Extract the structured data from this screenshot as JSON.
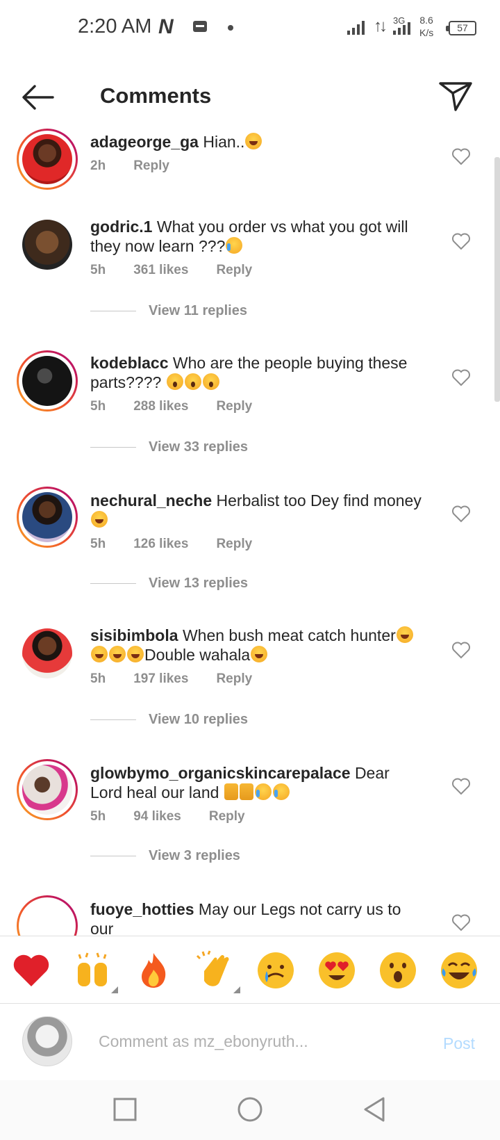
{
  "status_bar": {
    "time": "2:20 AM",
    "net_icon": "N",
    "network": "3G",
    "speed_value": "8.6",
    "speed_unit": "K/s",
    "battery": "57"
  },
  "header": {
    "title": "Comments",
    "back_icon": "arrow-left-icon",
    "send_icon": "paper-plane-icon"
  },
  "comments": [
    {
      "username": "adageorge_ga",
      "text": "Hian..",
      "emoji_after": [
        "laugh"
      ],
      "time": "2h",
      "likes": "",
      "reply_label": "Reply",
      "view_replies": ""
    },
    {
      "username": "godric.1",
      "text": "What you order vs what you got will they now learn ???",
      "emoji_after": [
        "cry"
      ],
      "time": "5h",
      "likes": "361 likes",
      "reply_label": "Reply",
      "view_replies": "View 11 replies"
    },
    {
      "username": "kodeblacc",
      "text": "Who are the people buying these parts????",
      "emoji_after": [
        "wow",
        "wow",
        "wow"
      ],
      "time": "5h",
      "likes": "288 likes",
      "reply_label": "Reply",
      "view_replies": "View 33 replies"
    },
    {
      "username": "nechural_neche",
      "text": "Herbalist too Dey find money",
      "emoji_after": [
        "laugh"
      ],
      "time": "5h",
      "likes": "126 likes",
      "reply_label": "Reply",
      "view_replies": "View 13 replies"
    },
    {
      "username": "sisibimbola",
      "text_part1": "When bush meat catch hunter",
      "text_part2": "Double wahala",
      "time": "5h",
      "likes": "197 likes",
      "reply_label": "Reply",
      "view_replies": "View 10 replies"
    },
    {
      "username": "glowbymo_organicskincarepalace",
      "text": "Dear Lord heal our land",
      "emoji_after": [
        "pray",
        "pray",
        "cry",
        "cry"
      ],
      "time": "5h",
      "likes": "94 likes",
      "reply_label": "Reply",
      "view_replies": "View 3 replies"
    },
    {
      "username": "fuoye_hotties",
      "text": "May our Legs not carry us to our",
      "time": "",
      "likes": "",
      "reply_label": "",
      "view_replies": ""
    }
  ],
  "reactions": [
    "red-heart",
    "raising-hands",
    "fire",
    "clapping-hands",
    "crying-face",
    "heart-eyes",
    "astonished-face",
    "tears-of-joy"
  ],
  "comment_input": {
    "placeholder": "Comment as mz_ebonyruth...",
    "post_label": "Post"
  },
  "nav_bar": {
    "buttons": [
      "recents-square-icon",
      "home-circle-icon",
      "back-triangle-icon"
    ]
  }
}
